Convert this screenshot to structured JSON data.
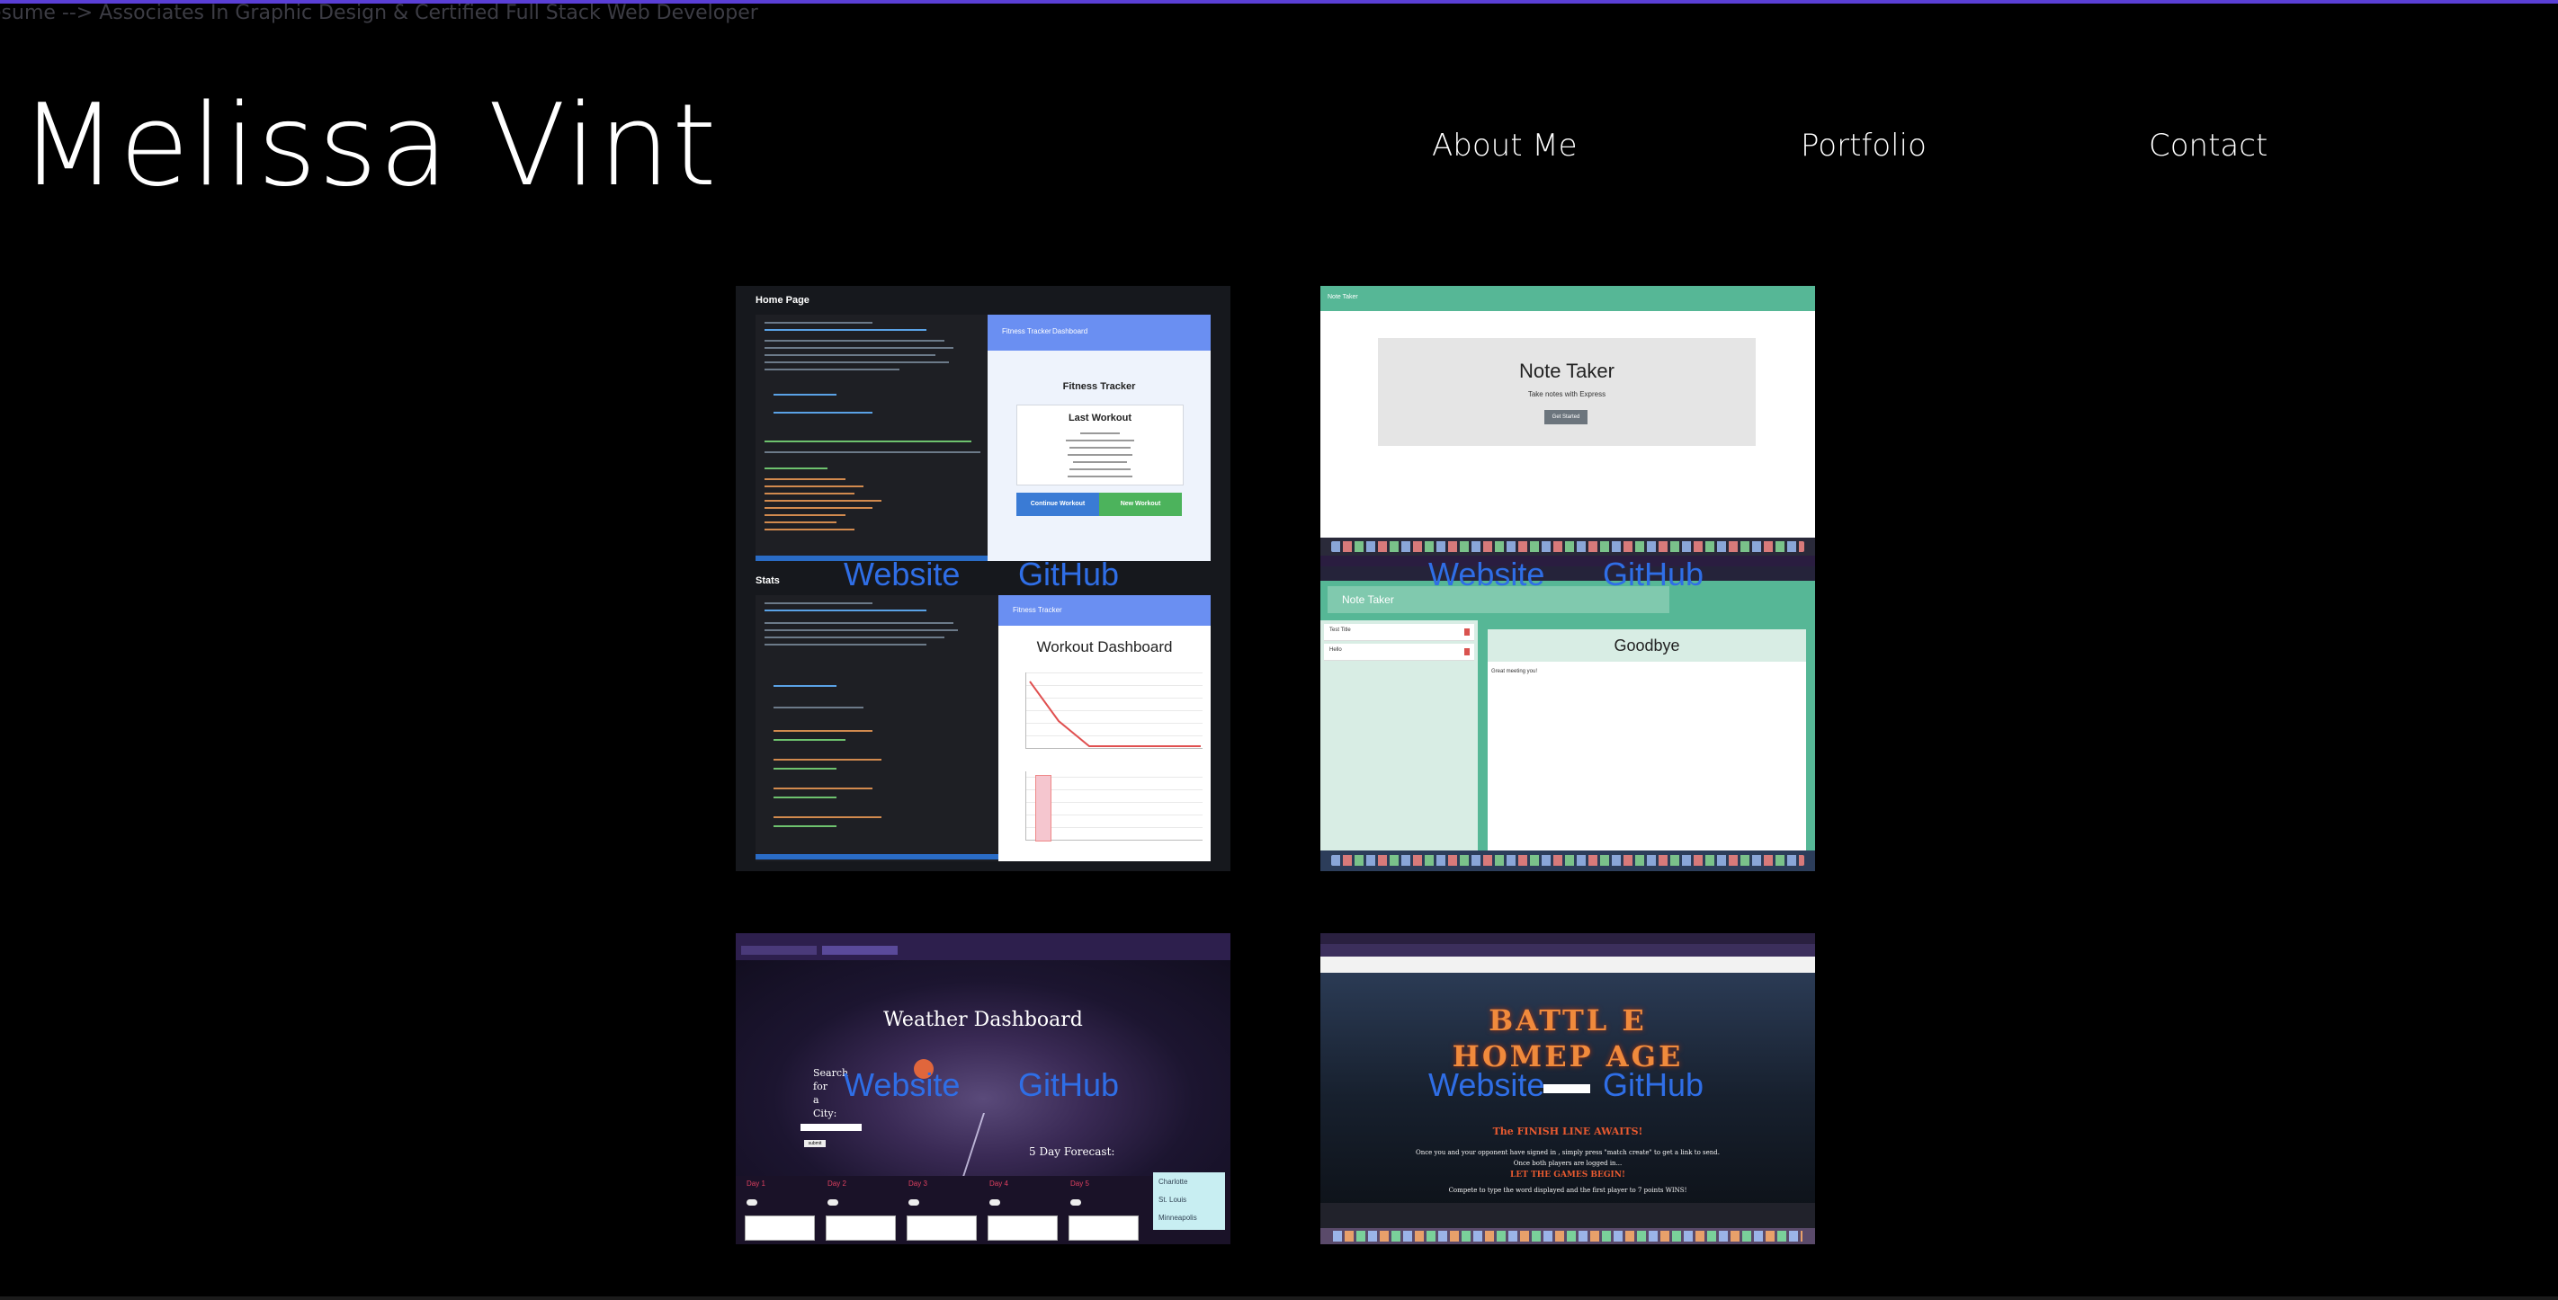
{
  "header": {
    "tagline": "esume --> Associates In Graphic Design & Certified Full Stack Web Developer",
    "name": "Melissa Vint"
  },
  "nav": {
    "about": "About Me",
    "portfolio": "Portfolio",
    "contact": "Contact"
  },
  "portfolio": {
    "cards": [
      {
        "website_label": "Website",
        "github_label": "GitHub",
        "screens": {
          "home_label": "Home Page",
          "stats_label": "Stats",
          "nav_brand": "Fitness Tracker",
          "nav_link": "Dashboard",
          "app_title": "Fitness Tracker",
          "box_title": "Last Workout",
          "continue_btn": "Continue Workout",
          "new_btn": "New Workout",
          "dash_nav": "Fitness Tracker",
          "dash_title": "Workout Dashboard"
        }
      },
      {
        "website_label": "Website",
        "github_label": "GitHub",
        "screens": {
          "topbar": "Note Taker",
          "hero_title": "Note Taker",
          "hero_sub": "Take notes with Express",
          "hero_btn": "Get Started",
          "app_title": "Note Taker",
          "notes": [
            "Test Title",
            "Hello"
          ],
          "note_title": "Goodbye",
          "note_body": "Great meeting you!"
        }
      },
      {
        "website_label": "Website",
        "github_label": "GitHub",
        "screens": {
          "title": "Weather Dashboard",
          "search_lines": [
            "Search",
            "for",
            "a",
            "City:"
          ],
          "submit": "submit",
          "forecast_title": "5 Day Forecast:",
          "days": [
            "Day 1",
            "Day 2",
            "Day 3",
            "Day 4",
            "Day 5"
          ],
          "cities": [
            "Charlotte",
            "St. Louis",
            "Minneapolis"
          ]
        }
      },
      {
        "website_label": "Website",
        "github_label": "GitHub",
        "screens": {
          "line1": "BATTL E",
          "line2": "HOMEP AGE",
          "finish": "The FINISH LINE AWAITS!",
          "body1": "Once you and your opponent have signed in , simply press \"match create\" to get a link to send.",
          "body2": "Once both players are logged in...",
          "games": "LET THE GAMES BEGIN!",
          "body3": "Compete to type the word displayed and the first player to 7 points WINS!"
        }
      }
    ]
  }
}
